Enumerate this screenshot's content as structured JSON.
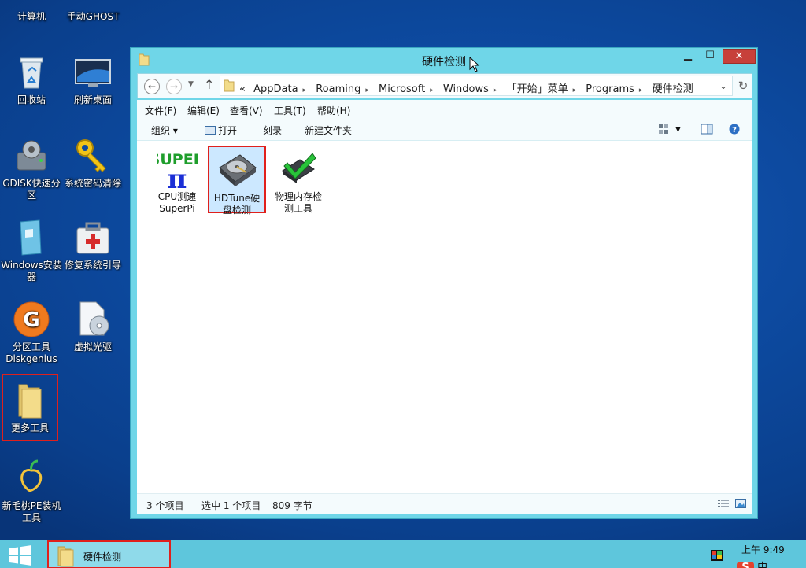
{
  "desktop": {
    "icons": [
      {
        "label": "计算机"
      },
      {
        "label": "手动GHOST"
      },
      {
        "label": "回收站"
      },
      {
        "label": "刷新桌面"
      },
      {
        "label": "GDISK快速分区"
      },
      {
        "label": "系统密码清除"
      },
      {
        "label": "Windows安装器"
      },
      {
        "label": "修复系统引导"
      },
      {
        "label": "分区工具Diskgenius"
      },
      {
        "label": "虚拟光驱"
      },
      {
        "label": "更多工具"
      },
      {
        "label": "新毛桃PE装机工具"
      }
    ]
  },
  "window": {
    "title": "硬件检测",
    "address": {
      "prefix": "«",
      "crumbs": [
        "AppData",
        "Roaming",
        "Microsoft",
        "Windows",
        "「开始」菜单",
        "Programs",
        "硬件检测"
      ]
    },
    "menu": [
      "文件(F)",
      "编辑(E)",
      "查看(V)",
      "工具(T)",
      "帮助(H)"
    ],
    "toolbar": {
      "organize": "组织 ▾",
      "open": "打开",
      "burn": "刻录",
      "new_folder": "新建文件夹"
    },
    "files": [
      {
        "label_line1": "CPU测速",
        "label_line2": "SuperPi",
        "icon": "superpi-icon"
      },
      {
        "label_line1": "HDTune硬",
        "label_line2": "盘检测",
        "icon": "harddisk-icon"
      },
      {
        "label_line1": "物理内存检",
        "label_line2": "测工具",
        "icon": "memory-chip-icon"
      }
    ],
    "status": {
      "count": "3 个项目",
      "selected": "选中 1 个项目",
      "size": "809 字节"
    }
  },
  "taskbar": {
    "task_label": "硬件检测",
    "clock": "上午 9:49",
    "ime": "中"
  },
  "colors": {
    "accent": "#6fd6e8",
    "selection_border": "#e0201c",
    "desktop": "#0d4aa0"
  }
}
